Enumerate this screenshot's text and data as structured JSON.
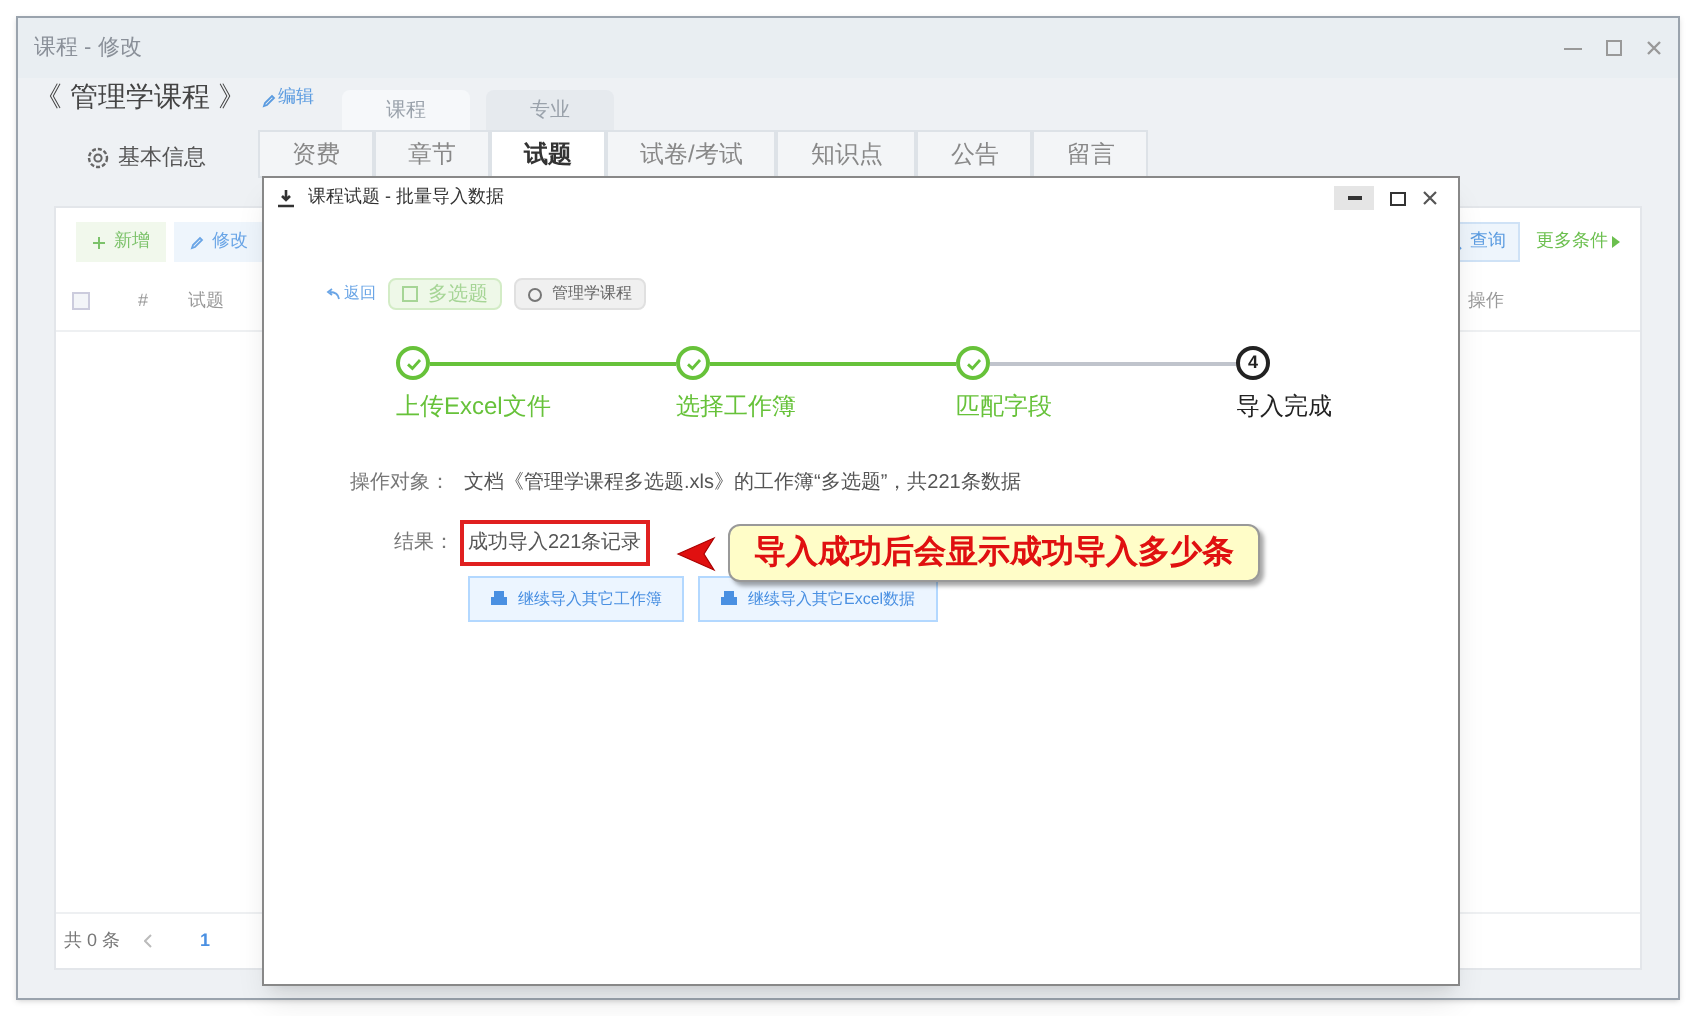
{
  "window": {
    "title": "课程 - 修改"
  },
  "course": {
    "title": "《 管理学课程 》",
    "edit_link": "编辑"
  },
  "top_tabs": [
    {
      "label": "课程",
      "selected": true
    },
    {
      "label": "专业",
      "selected": false
    }
  ],
  "side": {
    "label": "基本信息"
  },
  "section_tabs": [
    {
      "label": "资费",
      "selected": false
    },
    {
      "label": "章节",
      "selected": false
    },
    {
      "label": "试题",
      "selected": true
    },
    {
      "label": "试卷/考试",
      "selected": false
    },
    {
      "label": "知识点",
      "selected": false
    },
    {
      "label": "公告",
      "selected": false
    },
    {
      "label": "留言",
      "selected": false
    }
  ],
  "toolbar": {
    "add": "新增",
    "edit": "修改",
    "search": "查询",
    "more": "更多条件"
  },
  "table": {
    "select_all": {
      "checked": false
    },
    "columns": [
      "#",
      "试题",
      "操作"
    ]
  },
  "pagination": {
    "total": "共 0 条",
    "page": "1"
  },
  "dialog": {
    "title": "课程试题 - 批量导入数据",
    "back": "返回",
    "tags": [
      {
        "label": "多选题",
        "kind": "type"
      },
      {
        "label": "管理学课程",
        "kind": "course"
      }
    ],
    "steps": [
      {
        "label": "上传Excel文件",
        "done": true
      },
      {
        "label": "选择工作簿",
        "done": true
      },
      {
        "label": "匹配字段",
        "done": true
      },
      {
        "label": "导入完成",
        "done": false,
        "number": "4"
      }
    ],
    "target_label": "操作对象：",
    "target_text": "文档《管理学课程多选题.xls》的工作簿“多选题”，共221条数据",
    "result_label": "结果：",
    "result_text": "成功导入221条记录",
    "buttons": [
      "继续导入其它工作簿",
      "继续导入其它Excel数据"
    ]
  },
  "annotation": {
    "text": "导入成功后会显示成功导入多少条"
  }
}
